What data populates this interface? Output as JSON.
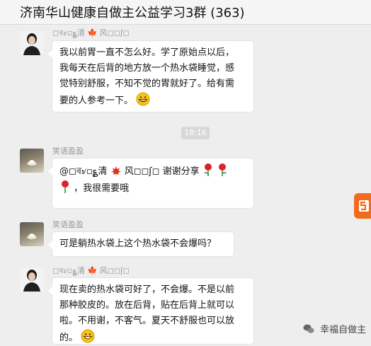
{
  "header": {
    "title": "济南华山健康自做主公益学习3群 (363)"
  },
  "messages": [
    {
      "nickname": "◻ৰ৶▫؏清 🍁 风◻◻ʃ◻",
      "lines": [
        "我以前胃一直不怎么好。学了原始点以后，",
        "我每天在后背的地方放一个热水袋睡觉，感",
        "觉特别舒服，不知不觉的胃就好了。给有需",
        "要的人参考一下。"
      ]
    },
    {
      "time": "18:16"
    },
    {
      "nickname": "笑语盈盈",
      "mention": "@◻ৰ৶▫؏清",
      "mention_rest": "风◻◻ʃ◻",
      "thanks": "谢谢分享",
      "line2": "，我很需要哦"
    },
    {
      "nickname": "笑语盈盈",
      "text": "可是躺热水袋上这个热水袋不会爆吗？"
    },
    {
      "nickname": "◻ৰ৶▫؏清 🍁 风◻◻ʃ◻",
      "lines": [
        "现在卖的热水袋可好了，不会爆。不是以前",
        "那种胶皮的。放在后背，贴在后背上就可以",
        "啦。不用谢，不客气。夏天不舒服也可以放",
        "的。"
      ]
    }
  ],
  "watermark": "幸福自做主",
  "icons": {
    "grin": "grinning-face-icon",
    "rose": "rose-icon",
    "maple": "maple-leaf-icon"
  },
  "colors": {
    "background": "#eeeeee",
    "bubble": "#ffffff",
    "badge": "#f26a1b"
  }
}
